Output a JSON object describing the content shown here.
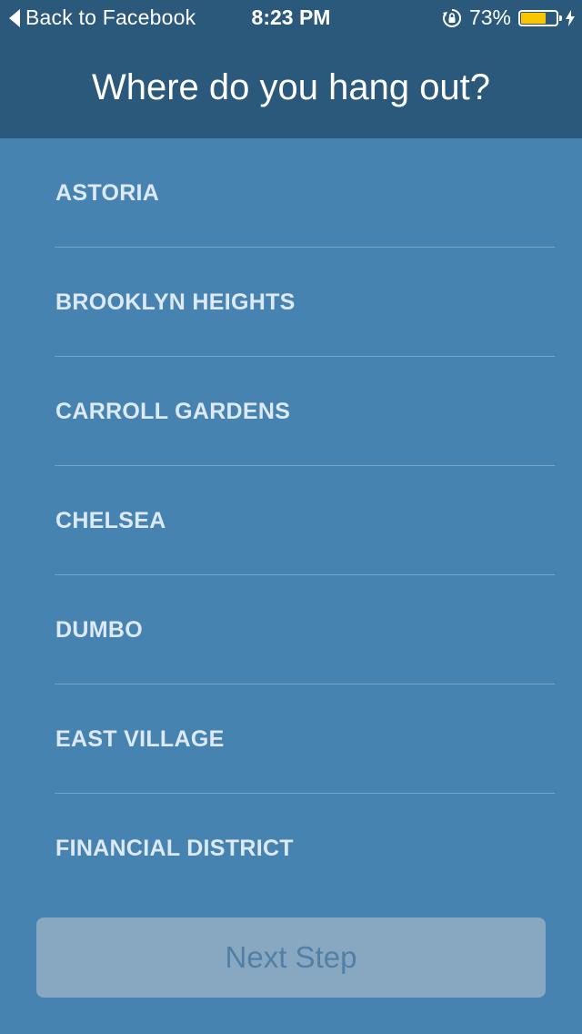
{
  "status_bar": {
    "back_label": "Back to Facebook",
    "time": "8:23 PM",
    "battery_percent": "73%",
    "battery_level": 0.73,
    "battery_color": "#f9c600"
  },
  "header": {
    "title": "Where do you hang out?",
    "background_color": "#2b597b"
  },
  "neighborhoods": [
    {
      "label": "ASTORIA"
    },
    {
      "label": "BROOKLYN HEIGHTS"
    },
    {
      "label": "CARROLL GARDENS"
    },
    {
      "label": "CHELSEA"
    },
    {
      "label": "DUMBO"
    },
    {
      "label": "EAST VILLAGE"
    },
    {
      "label": "FINANCIAL DISTRICT"
    }
  ],
  "footer": {
    "next_label": "Next Step"
  },
  "colors": {
    "background": "#4683b0",
    "label": "#ddeaf5",
    "button_bg": "#88a8c2",
    "button_text": "#527fa5"
  },
  "icons": [
    "back-chevron-icon",
    "rotation-lock-icon",
    "battery-icon",
    "charging-bolt-icon"
  ]
}
